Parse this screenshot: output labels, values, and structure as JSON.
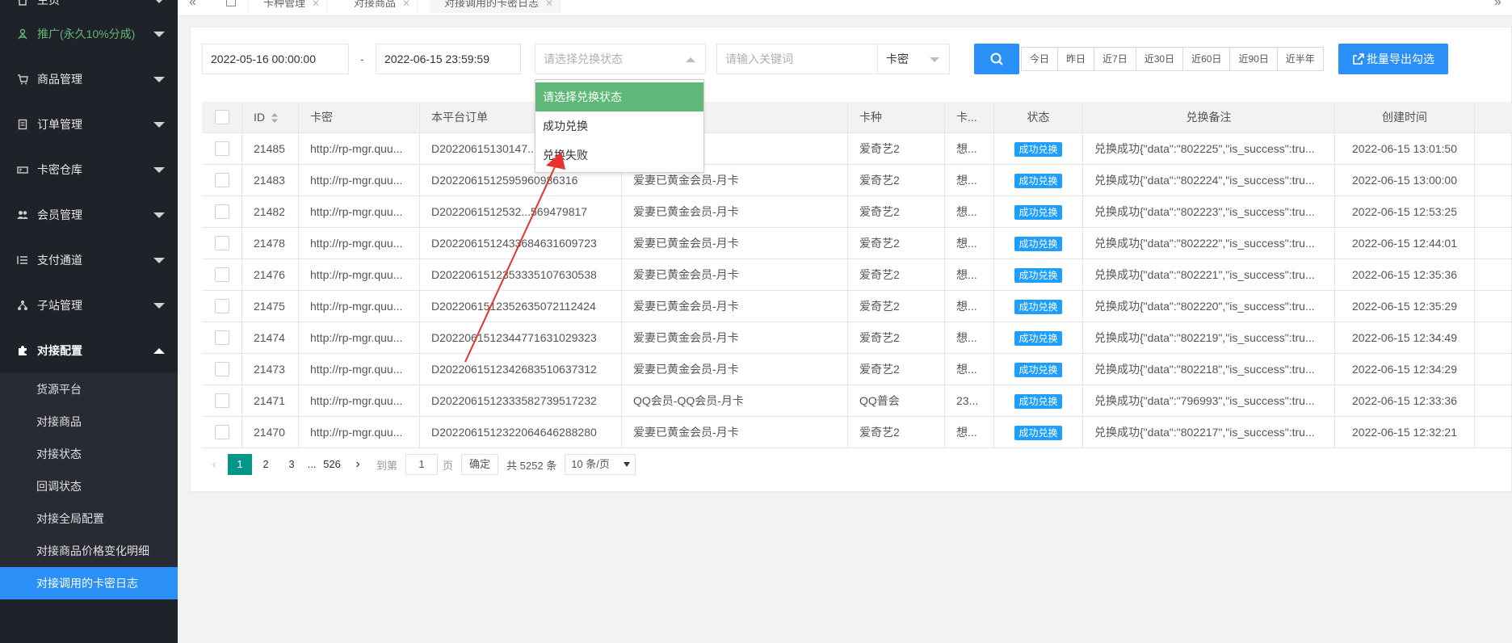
{
  "sidebar": {
    "items": [
      {
        "label": "主页",
        "icon": "home-icon"
      },
      {
        "label": "推广(永久10%分成)",
        "icon": "promote-icon"
      },
      {
        "label": "商品管理",
        "icon": "cart-icon"
      },
      {
        "label": "订单管理",
        "icon": "order-icon"
      },
      {
        "label": "卡密仓库",
        "icon": "card-icon"
      },
      {
        "label": "会员管理",
        "icon": "users-icon"
      },
      {
        "label": "支付通道",
        "icon": "list-icon"
      },
      {
        "label": "子站管理",
        "icon": "sitemap-icon"
      },
      {
        "label": "对接配置",
        "icon": "puzzle-icon"
      }
    ],
    "sub_items": [
      {
        "label": "货源平台"
      },
      {
        "label": "对接商品"
      },
      {
        "label": "对接状态"
      },
      {
        "label": "回调状态"
      },
      {
        "label": "对接全局配置"
      },
      {
        "label": "对接商品价格变化明细"
      },
      {
        "label": "对接调用的卡密日志"
      }
    ]
  },
  "tabs": [
    {
      "label": "卡种管理"
    },
    {
      "label": "对接商品"
    },
    {
      "label": "对接调用的卡密日志"
    }
  ],
  "filters": {
    "start_date": "2022-05-16 00:00:00",
    "separator": "-",
    "end_date": "2022-06-15 23:59:59",
    "status_placeholder": "请选择兑换状态",
    "keyword_placeholder": "请输入关键词",
    "keyword_type": "卡密",
    "quick_ranges": [
      "今日",
      "昨日",
      "近7日",
      "近30日",
      "近60日",
      "近90日",
      "近半年"
    ],
    "export_label": "批量导出勾选"
  },
  "dropdown": {
    "options": [
      "请选择兑换状态",
      "成功兑换",
      "兑换失败"
    ]
  },
  "table": {
    "headers": [
      "ID",
      "卡密",
      "本平台订单",
      "",
      "卡种",
      "卡...",
      "状态",
      "兑换备注",
      "创建时间"
    ],
    "rows": [
      {
        "id": "21485",
        "km": "http://rp-mgr.quu...",
        "order": "D20220615130147...",
        "name": "...员-月卡",
        "kind": "爱奇艺2",
        "ka": "想...",
        "status": "成功兑换",
        "note": "兑换成功{\"data\":\"802225\",\"is_success\":tru...",
        "time": "2022-06-15 13:01:50"
      },
      {
        "id": "21483",
        "km": "http://rp-mgr.quu...",
        "order": "D2022061512595960986316",
        "name": "爱妻已黄金会员-月卡",
        "kind": "爱奇艺2",
        "ka": "想...",
        "status": "成功兑换",
        "note": "兑换成功{\"data\":\"802224\",\"is_success\":tru...",
        "time": "2022-06-15 13:00:00"
      },
      {
        "id": "21482",
        "km": "http://rp-mgr.quu...",
        "order": "D2022061512532...569479817",
        "name": "爱妻已黄金会员-月卡",
        "kind": "爱奇艺2",
        "ka": "想...",
        "status": "成功兑换",
        "note": "兑换成功{\"data\":\"802223\",\"is_success\":tru...",
        "time": "2022-06-15 12:53:25"
      },
      {
        "id": "21478",
        "km": "http://rp-mgr.quu...",
        "order": "D2022061512433684631609723",
        "name": "爱妻已黄金会员-月卡",
        "kind": "爱奇艺2",
        "ka": "想...",
        "status": "成功兑换",
        "note": "兑换成功{\"data\":\"802222\",\"is_success\":tru...",
        "time": "2022-06-15 12:44:01"
      },
      {
        "id": "21476",
        "km": "http://rp-mgr.quu...",
        "order": "D2022061512353335107630538",
        "name": "爱妻已黄金会员-月卡",
        "kind": "爱奇艺2",
        "ka": "想...",
        "status": "成功兑换",
        "note": "兑换成功{\"data\":\"802221\",\"is_success\":tru...",
        "time": "2022-06-15 12:35:36"
      },
      {
        "id": "21475",
        "km": "http://rp-mgr.quu...",
        "order": "D2022061512352635072112424",
        "name": "爱妻已黄金会员-月卡",
        "kind": "爱奇艺2",
        "ka": "想...",
        "status": "成功兑换",
        "note": "兑换成功{\"data\":\"802220\",\"is_success\":tru...",
        "time": "2022-06-15 12:35:29"
      },
      {
        "id": "21474",
        "km": "http://rp-mgr.quu...",
        "order": "D2022061512344771631029323",
        "name": "爱妻已黄金会员-月卡",
        "kind": "爱奇艺2",
        "ka": "想...",
        "status": "成功兑换",
        "note": "兑换成功{\"data\":\"802219\",\"is_success\":tru...",
        "time": "2022-06-15 12:34:49"
      },
      {
        "id": "21473",
        "km": "http://rp-mgr.quu...",
        "order": "D2022061512342683510637312",
        "name": "爱妻已黄金会员-月卡",
        "kind": "爱奇艺2",
        "ka": "想...",
        "status": "成功兑换",
        "note": "兑换成功{\"data\":\"802218\",\"is_success\":tru...",
        "time": "2022-06-15 12:34:29"
      },
      {
        "id": "21471",
        "km": "http://rp-mgr.quu...",
        "order": "D2022061512333582739517232",
        "name": "QQ会员-QQ会员-月卡",
        "kind": "QQ普会",
        "ka": "23...",
        "status": "成功兑换",
        "note": "兑换成功{\"data\":\"796993\",\"is_success\":tru...",
        "time": "2022-06-15 12:33:36"
      },
      {
        "id": "21470",
        "km": "http://rp-mgr.quu...",
        "order": "D2022061512322064646288280",
        "name": "爱妻已黄金会员-月卡",
        "kind": "爱奇艺2",
        "ka": "想...",
        "status": "成功兑换",
        "note": "兑换成功{\"data\":\"802217\",\"is_success\":tru...",
        "time": "2022-06-15 12:32:21"
      }
    ]
  },
  "pager": {
    "pages": [
      "1",
      "2",
      "3",
      "...",
      "526"
    ],
    "goto_label": "到第",
    "goto_value": "1",
    "page_unit": "页",
    "confirm_label": "确定",
    "total_label": "共 5252 条",
    "page_size": "10 条/页"
  },
  "colors": {
    "sidebar_bg": "#20222a",
    "accent_blue": "#2a8ff7",
    "green_selected": "#5fb878",
    "pager_current": "#009688",
    "annotation_red": "#e8322d"
  }
}
